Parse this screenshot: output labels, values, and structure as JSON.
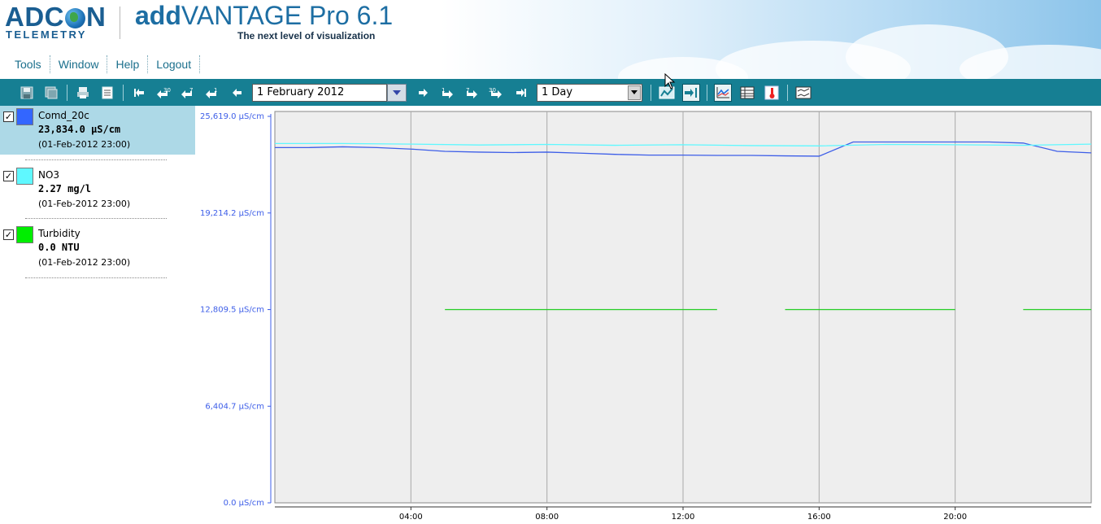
{
  "header": {
    "logo_main_left": "ADC",
    "logo_main_right": "N",
    "logo_sub": "TELEMETRY",
    "product_bold": "add",
    "product_rest": "VANTAGE Pro 6.1",
    "tagline": "The next level of visualization"
  },
  "menu": [
    {
      "label": "Tools"
    },
    {
      "label": "Window"
    },
    {
      "label": "Help"
    },
    {
      "label": "Logout"
    }
  ],
  "toolbar": {
    "date_value": "1 February 2012",
    "period_value": "1 Day",
    "nav_labels": {
      "back30": "30",
      "back7": "7",
      "back1": "1",
      "fwd1": "1",
      "fwd7": "7",
      "fwd30": "30"
    }
  },
  "sidebar": {
    "items": [
      {
        "name": "Comd_20c",
        "value": "23,834.0 µS/cm",
        "time": "(01-Feb-2012 23:00)",
        "color": "#3366ff",
        "checked": true,
        "selected": true
      },
      {
        "name": "NO3",
        "value": "2.27 mg/l",
        "time": "(01-Feb-2012 23:00)",
        "color": "#5ff8ff",
        "checked": true,
        "selected": false
      },
      {
        "name": "Turbidity",
        "value": "0.0 NTU",
        "time": "(01-Feb-2012 23:00)",
        "color": "#00ee00",
        "checked": true,
        "selected": false
      }
    ]
  },
  "chart_data": {
    "type": "line",
    "y_unit": "µS/cm",
    "ylim": [
      0,
      25619.0
    ],
    "yticks": [
      {
        "value": 25619.0,
        "label": "25,619.0 µS/cm"
      },
      {
        "value": 19214.2,
        "label": "19,214.2 µS/cm"
      },
      {
        "value": 12809.5,
        "label": "12,809.5 µS/cm"
      },
      {
        "value": 6404.7,
        "label": "6,404.7 µS/cm"
      },
      {
        "value": 0,
        "label": "0.0 µS/cm"
      }
    ],
    "xlim": [
      0,
      24
    ],
    "xticks": [
      {
        "value": 4,
        "label": "04:00"
      },
      {
        "value": 8,
        "label": "08:00"
      },
      {
        "value": 12,
        "label": "12:00"
      },
      {
        "value": 16,
        "label": "16:00"
      },
      {
        "value": 20,
        "label": "20:00"
      }
    ],
    "grid": "vertical",
    "series": [
      {
        "name": "Comd_20c",
        "color": "#3d5ee8",
        "segments": [
          [
            [
              0,
              23550
            ],
            [
              1,
              23550
            ],
            [
              2,
              23600
            ],
            [
              3,
              23550
            ],
            [
              4,
              23450
            ],
            [
              5,
              23300
            ],
            [
              6,
              23250
            ],
            [
              7,
              23220
            ],
            [
              8,
              23250
            ],
            [
              9,
              23180
            ],
            [
              10,
              23100
            ],
            [
              11,
              23050
            ],
            [
              12,
              23050
            ],
            [
              13,
              23030
            ],
            [
              14,
              23030
            ],
            [
              15,
              23000
            ],
            [
              16,
              22980
            ],
            [
              17,
              23920
            ],
            [
              18,
              23920
            ],
            [
              19,
              23920
            ],
            [
              20,
              23920
            ],
            [
              21,
              23920
            ],
            [
              22,
              23850
            ],
            [
              23,
              23300
            ],
            [
              24,
              23200
            ]
          ]
        ]
      },
      {
        "name": "NO3",
        "color": "#5ff8ff",
        "segments": [
          [
            [
              0,
              23820
            ],
            [
              2,
              23820
            ],
            [
              4,
              23780
            ],
            [
              6,
              23720
            ],
            [
              8,
              23760
            ],
            [
              10,
              23700
            ],
            [
              12,
              23740
            ],
            [
              14,
              23680
            ],
            [
              16,
              23660
            ],
            [
              18,
              23760
            ],
            [
              20,
              23740
            ],
            [
              22,
              23700
            ],
            [
              24,
              23780
            ]
          ]
        ]
      },
      {
        "name": "Turbidity",
        "color": "#22cc22",
        "segments": [
          [
            [
              5,
              12809.5
            ],
            [
              13,
              12809.5
            ]
          ],
          [
            [
              15,
              12809.5
            ],
            [
              20,
              12809.5
            ]
          ],
          [
            [
              22,
              12809.5
            ],
            [
              24,
              12809.5
            ]
          ]
        ]
      }
    ]
  }
}
